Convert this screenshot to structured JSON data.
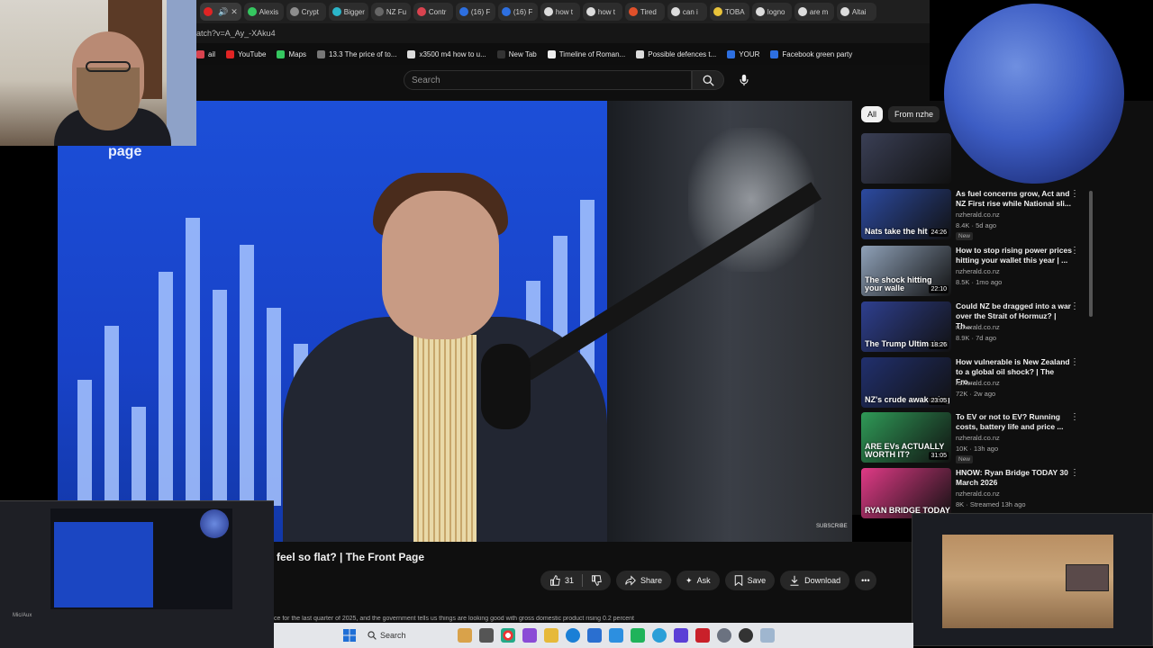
{
  "browser": {
    "tabs": [
      {
        "label": "",
        "color": "#e02424"
      },
      {
        "label": "Alexis",
        "color": "#35c760"
      },
      {
        "label": "Crypt",
        "color": "#8d8d8d"
      },
      {
        "label": "Bigger",
        "color": "#2bb5c9"
      },
      {
        "label": "NZ Fu",
        "color": "#666666"
      },
      {
        "label": "Contr",
        "color": "#d9434f"
      },
      {
        "label": "(16) F",
        "color": "#2d6fe0"
      },
      {
        "label": "(16) F",
        "color": "#2d6fe0"
      },
      {
        "label": "how t",
        "color": "#dcdcdc"
      },
      {
        "label": "how t",
        "color": "#dcdcdc"
      },
      {
        "label": "Tired",
        "color": "#e0502a"
      },
      {
        "label": "can i",
        "color": "#dcdcdc"
      },
      {
        "label": "TOBA",
        "color": "#e9c33a"
      },
      {
        "label": "logno",
        "color": "#dcdcdc"
      },
      {
        "label": "are m",
        "color": "#dcdcdc"
      },
      {
        "label": "Altai",
        "color": "#dcdcdc"
      }
    ],
    "url": "atch?v=A_Ay_-XAku4",
    "bookmarks": [
      {
        "label": "ail",
        "color": "#d9434f"
      },
      {
        "label": "YouTube",
        "color": "#e02424"
      },
      {
        "label": "Maps",
        "color": "#35c760"
      },
      {
        "label": "13.3 The price of to...",
        "color": "#777777"
      },
      {
        "label": "x3500 m4 how to u...",
        "color": "#dcdcdc"
      },
      {
        "label": "New Tab",
        "color": "#333333"
      },
      {
        "label": "Timeline of Roman...",
        "color": "#eeeeee"
      },
      {
        "label": "Possible defences t...",
        "color": "#dcdcdc"
      },
      {
        "label": "YOUR",
        "color": "#2d6fe0"
      },
      {
        "label": "Facebook green party",
        "color": "#2d6fe0"
      }
    ]
  },
  "youtube": {
    "search_placeholder": "Search",
    "video_logo": "page",
    "watermark": "SUBSCRIBE",
    "title": "feel so flat? | The Front Page",
    "likes": "31",
    "actions": {
      "share": "Share",
      "ask": "Ask",
      "save": "Save",
      "download": "Download"
    },
    "description": "ce for the last quarter of 2025, and the government tells us things are looking good with gross domestic product rising 0.2 percent",
    "chips": {
      "all": "All",
      "from": "From nzhe"
    }
  },
  "related": [
    {
      "title": "",
      "channel": "",
      "meta": "",
      "duration": "",
      "thumb_label": "",
      "thumb_color": "#3a3f55",
      "badge": ""
    },
    {
      "title": "As fuel concerns grow, Act and NZ First rise while National sli...",
      "channel": "nzherald.co.nz",
      "meta": "8.4K · 5d ago",
      "duration": "24:26",
      "thumb_label": "Nats take the hit",
      "thumb_color": "#2c4aa0",
      "badge": "New"
    },
    {
      "title": "How to stop rising power prices hitting your wallet this year | ...",
      "channel": "nzherald.co.nz",
      "meta": "8.5K · 1mo ago",
      "duration": "22:10",
      "thumb_label": "The shock hitting your walle",
      "thumb_color": "#8fa1b8",
      "badge": ""
    },
    {
      "title": "Could NZ be dragged into a war over the Strait of Hormuz? | Th...",
      "channel": "nzherald.co.nz",
      "meta": "8.9K · 7d ago",
      "duration": "18:26",
      "thumb_label": "The Trump Ultimatum",
      "thumb_color": "#2e3f8f",
      "badge": ""
    },
    {
      "title": "How vulnerable is New Zealand to a global oil shock? | The Fro...",
      "channel": "nzherald.co.nz",
      "meta": "72K · 2w ago",
      "duration": "23:05",
      "thumb_label": "NZ's crude awakening",
      "thumb_color": "#21306e",
      "badge": ""
    },
    {
      "title": "To EV or not to EV? Running costs, battery life and price ...",
      "channel": "nzherald.co.nz",
      "meta": "10K · 13h ago",
      "duration": "31:05",
      "thumb_label": "ARE EVs ACTUALLY WORTH IT?",
      "thumb_color": "#2f9a57",
      "badge": "New"
    },
    {
      "title": "HNOW: Ryan Bridge TODAY 30 March 2026",
      "channel": "nzherald.co.nz",
      "meta": "8K · Streamed 13h ago",
      "duration": "",
      "thumb_label": "RYAN BRIDGE TODAY",
      "thumb_color": "#e03a86",
      "badge": ""
    }
  ],
  "obs": {
    "label": "Mic/Aux"
  },
  "taskbar": {
    "search_label": "Search"
  }
}
